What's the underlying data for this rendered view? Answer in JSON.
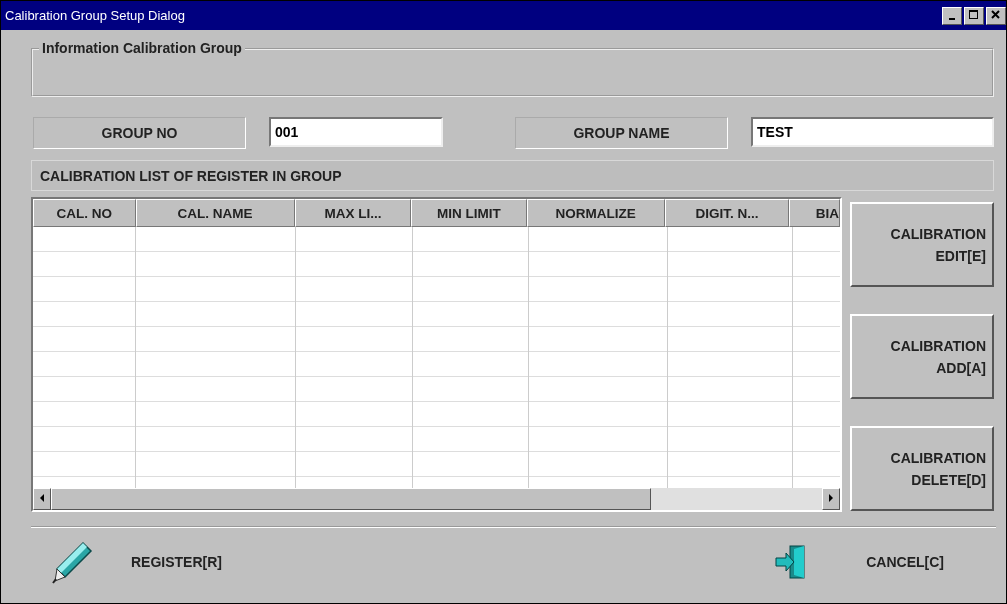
{
  "window": {
    "title": "Calibration Group Setup Dialog"
  },
  "info_group": {
    "title": "Information Calibration Group"
  },
  "fields": [
    {
      "label": "GROUP NO",
      "value": "001"
    },
    {
      "label": "GROUP NAME",
      "value": "TEST"
    }
  ],
  "list_title": "CALIBRATION LIST OF REGISTER IN GROUP",
  "table": {
    "columns": [
      "CAL. NO",
      "CAL. NAME",
      "MAX LI...",
      "MIN LIMIT",
      "NORMALIZE",
      "DIGIT. N...",
      "BIA"
    ]
  },
  "side_buttons": [
    {
      "label": "CALIBRATION EDIT[E]"
    },
    {
      "label": "CALIBRATION ADD[A]"
    },
    {
      "label": "CALIBRATION DELETE[D]"
    }
  ],
  "footer_buttons": [
    {
      "kind": "register",
      "label": "REGISTER[R]"
    },
    {
      "kind": "cancel",
      "label": "CANCEL[C]"
    }
  ]
}
